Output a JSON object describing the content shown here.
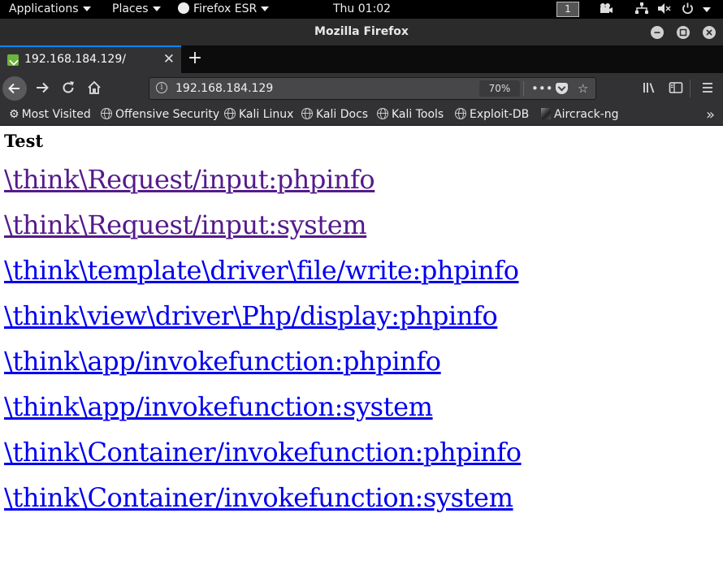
{
  "top_panel": {
    "applications": "Applications",
    "places": "Places",
    "firefox_menu": "Firefox ESR",
    "clock": "Thu 01:02",
    "workspace": "1"
  },
  "window": {
    "title": "Mozilla Firefox"
  },
  "tab": {
    "label": "192.168.184.129/",
    "new_tab": "+"
  },
  "urlbar": {
    "value": "192.168.184.129",
    "zoom": "70%"
  },
  "bookmarks": [
    {
      "label": "Most Visited",
      "icon": "gear-icon"
    },
    {
      "label": "Offensive Security",
      "icon": "globe-icon"
    },
    {
      "label": "Kali Linux",
      "icon": "globe-icon"
    },
    {
      "label": "Kali Docs",
      "icon": "globe-icon"
    },
    {
      "label": "Kali Tools",
      "icon": "globe-icon"
    },
    {
      "label": "Exploit-DB",
      "icon": "globe-icon"
    },
    {
      "label": "Aircrack-ng",
      "icon": "aircrack-icon"
    }
  ],
  "page": {
    "heading": "Test",
    "links": [
      {
        "text": "\\think\\Request/input:phpinfo",
        "visited": true
      },
      {
        "text": "\\think\\Request/input:system",
        "visited": true
      },
      {
        "text": "\\think\\template\\driver\\file/write:phpinfo",
        "visited": false
      },
      {
        "text": "\\think\\view\\driver\\Php/display:phpinfo",
        "visited": false
      },
      {
        "text": "\\think\\app/invokefunction:phpinfo",
        "visited": false
      },
      {
        "text": "\\think\\app/invokefunction:system",
        "visited": false
      },
      {
        "text": "\\think\\Container/invokefunction:phpinfo",
        "visited": false
      },
      {
        "text": "\\think\\Container/invokefunction:system",
        "visited": false
      }
    ]
  },
  "colors": {
    "link": "#0000ee",
    "visited_link": "#551a8b",
    "accent": "#0a84ff"
  }
}
